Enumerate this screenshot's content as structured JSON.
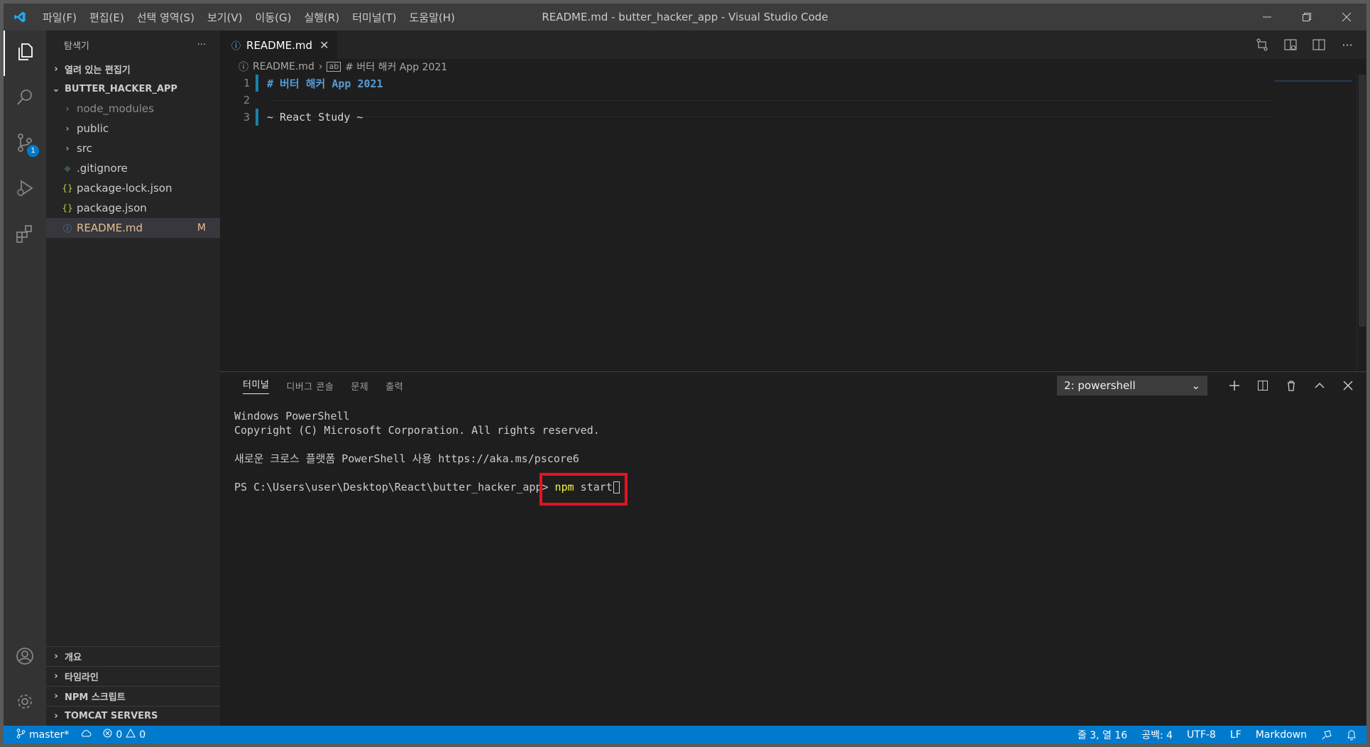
{
  "window": {
    "title": "README.md - butter_hacker_app - Visual Studio Code",
    "menu": [
      "파일(F)",
      "편집(E)",
      "선택 영역(S)",
      "보기(V)",
      "이동(G)",
      "실행(R)",
      "터미널(T)",
      "도움말(H)"
    ]
  },
  "activity_bar": {
    "scm_badge": "1"
  },
  "explorer": {
    "header": "탐색기",
    "more": "···",
    "open_editors": "열려 있는 편집기",
    "project": "BUTTER_HACKER_APP",
    "items": [
      {
        "label": "node_modules",
        "kind": "folder"
      },
      {
        "label": "public",
        "kind": "folder"
      },
      {
        "label": "src",
        "kind": "folder"
      },
      {
        "label": ".gitignore",
        "kind": "gitignore"
      },
      {
        "label": "package-lock.json",
        "kind": "json"
      },
      {
        "label": "package.json",
        "kind": "json"
      },
      {
        "label": "README.md",
        "kind": "markdown",
        "badge": "M"
      }
    ],
    "bottom_sections": [
      "개요",
      "타임라인",
      "NPM 스크립트",
      "TOMCAT SERVERS"
    ]
  },
  "editor": {
    "tab_label": "README.md",
    "breadcrumb": {
      "file": "README.md",
      "symbol": "# 버터 해커 App 2021"
    },
    "lines": [
      {
        "num": "1",
        "text": "# 버터 해커 App 2021"
      },
      {
        "num": "2",
        "text": ""
      },
      {
        "num": "3",
        "text": "~ React Study ~"
      }
    ]
  },
  "panel": {
    "tabs": [
      "터미널",
      "디버그 콘솔",
      "문제",
      "출력"
    ],
    "terminal_select": "2: powershell",
    "output": {
      "line1": "Windows PowerShell",
      "line2": "Copyright (C) Microsoft Corporation. All rights reserved.",
      "line3": "새로운 크로스 플랫폼 PowerShell 사용 https://aka.ms/pscore6",
      "prompt": "PS C:\\Users\\user\\Desktop\\React\\butter_hacker_app> ",
      "command": "npm",
      "argument": " start"
    }
  },
  "status_bar": {
    "branch": "master*",
    "errors": "0",
    "warnings": "0",
    "position": "줄 3, 열 16",
    "spaces": "공백: 4",
    "encoding": "UTF-8",
    "eol": "LF",
    "language": "Markdown"
  },
  "colors": {
    "accent": "#007acc",
    "highlight_box": "#e81123",
    "modified": "#e2c08d"
  }
}
